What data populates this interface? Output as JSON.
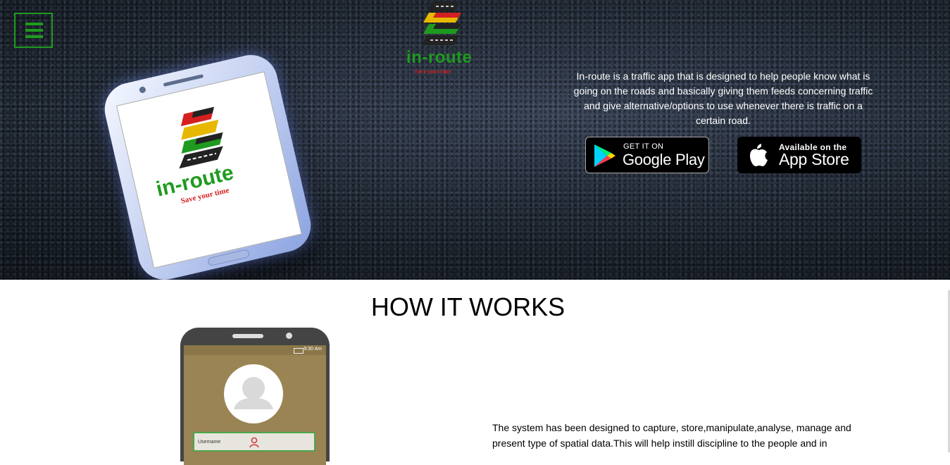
{
  "nav": {
    "menu_icon": "hamburger-menu-icon"
  },
  "brand": {
    "name": "in-route",
    "tagline": "Save your time"
  },
  "hero": {
    "description": "In-route is a traffic app that is designed to help people know what is going on the roads and basically giving them feeds concerning traffic and give alternative/options to use whenever there is traffic on a certain road.",
    "google_play": {
      "small": "GET IT ON",
      "big": "Google Play",
      "icon": "google-play-icon"
    },
    "app_store": {
      "small": "Available on the",
      "big": "App Store",
      "icon": "apple-icon"
    }
  },
  "how_it_works": {
    "title": "HOW IT WORKS",
    "phone": {
      "time": "9:30 Am",
      "field_label": "Username"
    },
    "body": "The system has been designed to capture, store,manipulate,analyse, manage and present type of spatial data.This will help instill discipline to the people and in"
  },
  "colors": {
    "accent": "#1f9a1f",
    "tagline": "#d42020",
    "logo_red": "#d42020",
    "logo_yellow": "#e6b800",
    "logo_green": "#1f9a1f"
  }
}
